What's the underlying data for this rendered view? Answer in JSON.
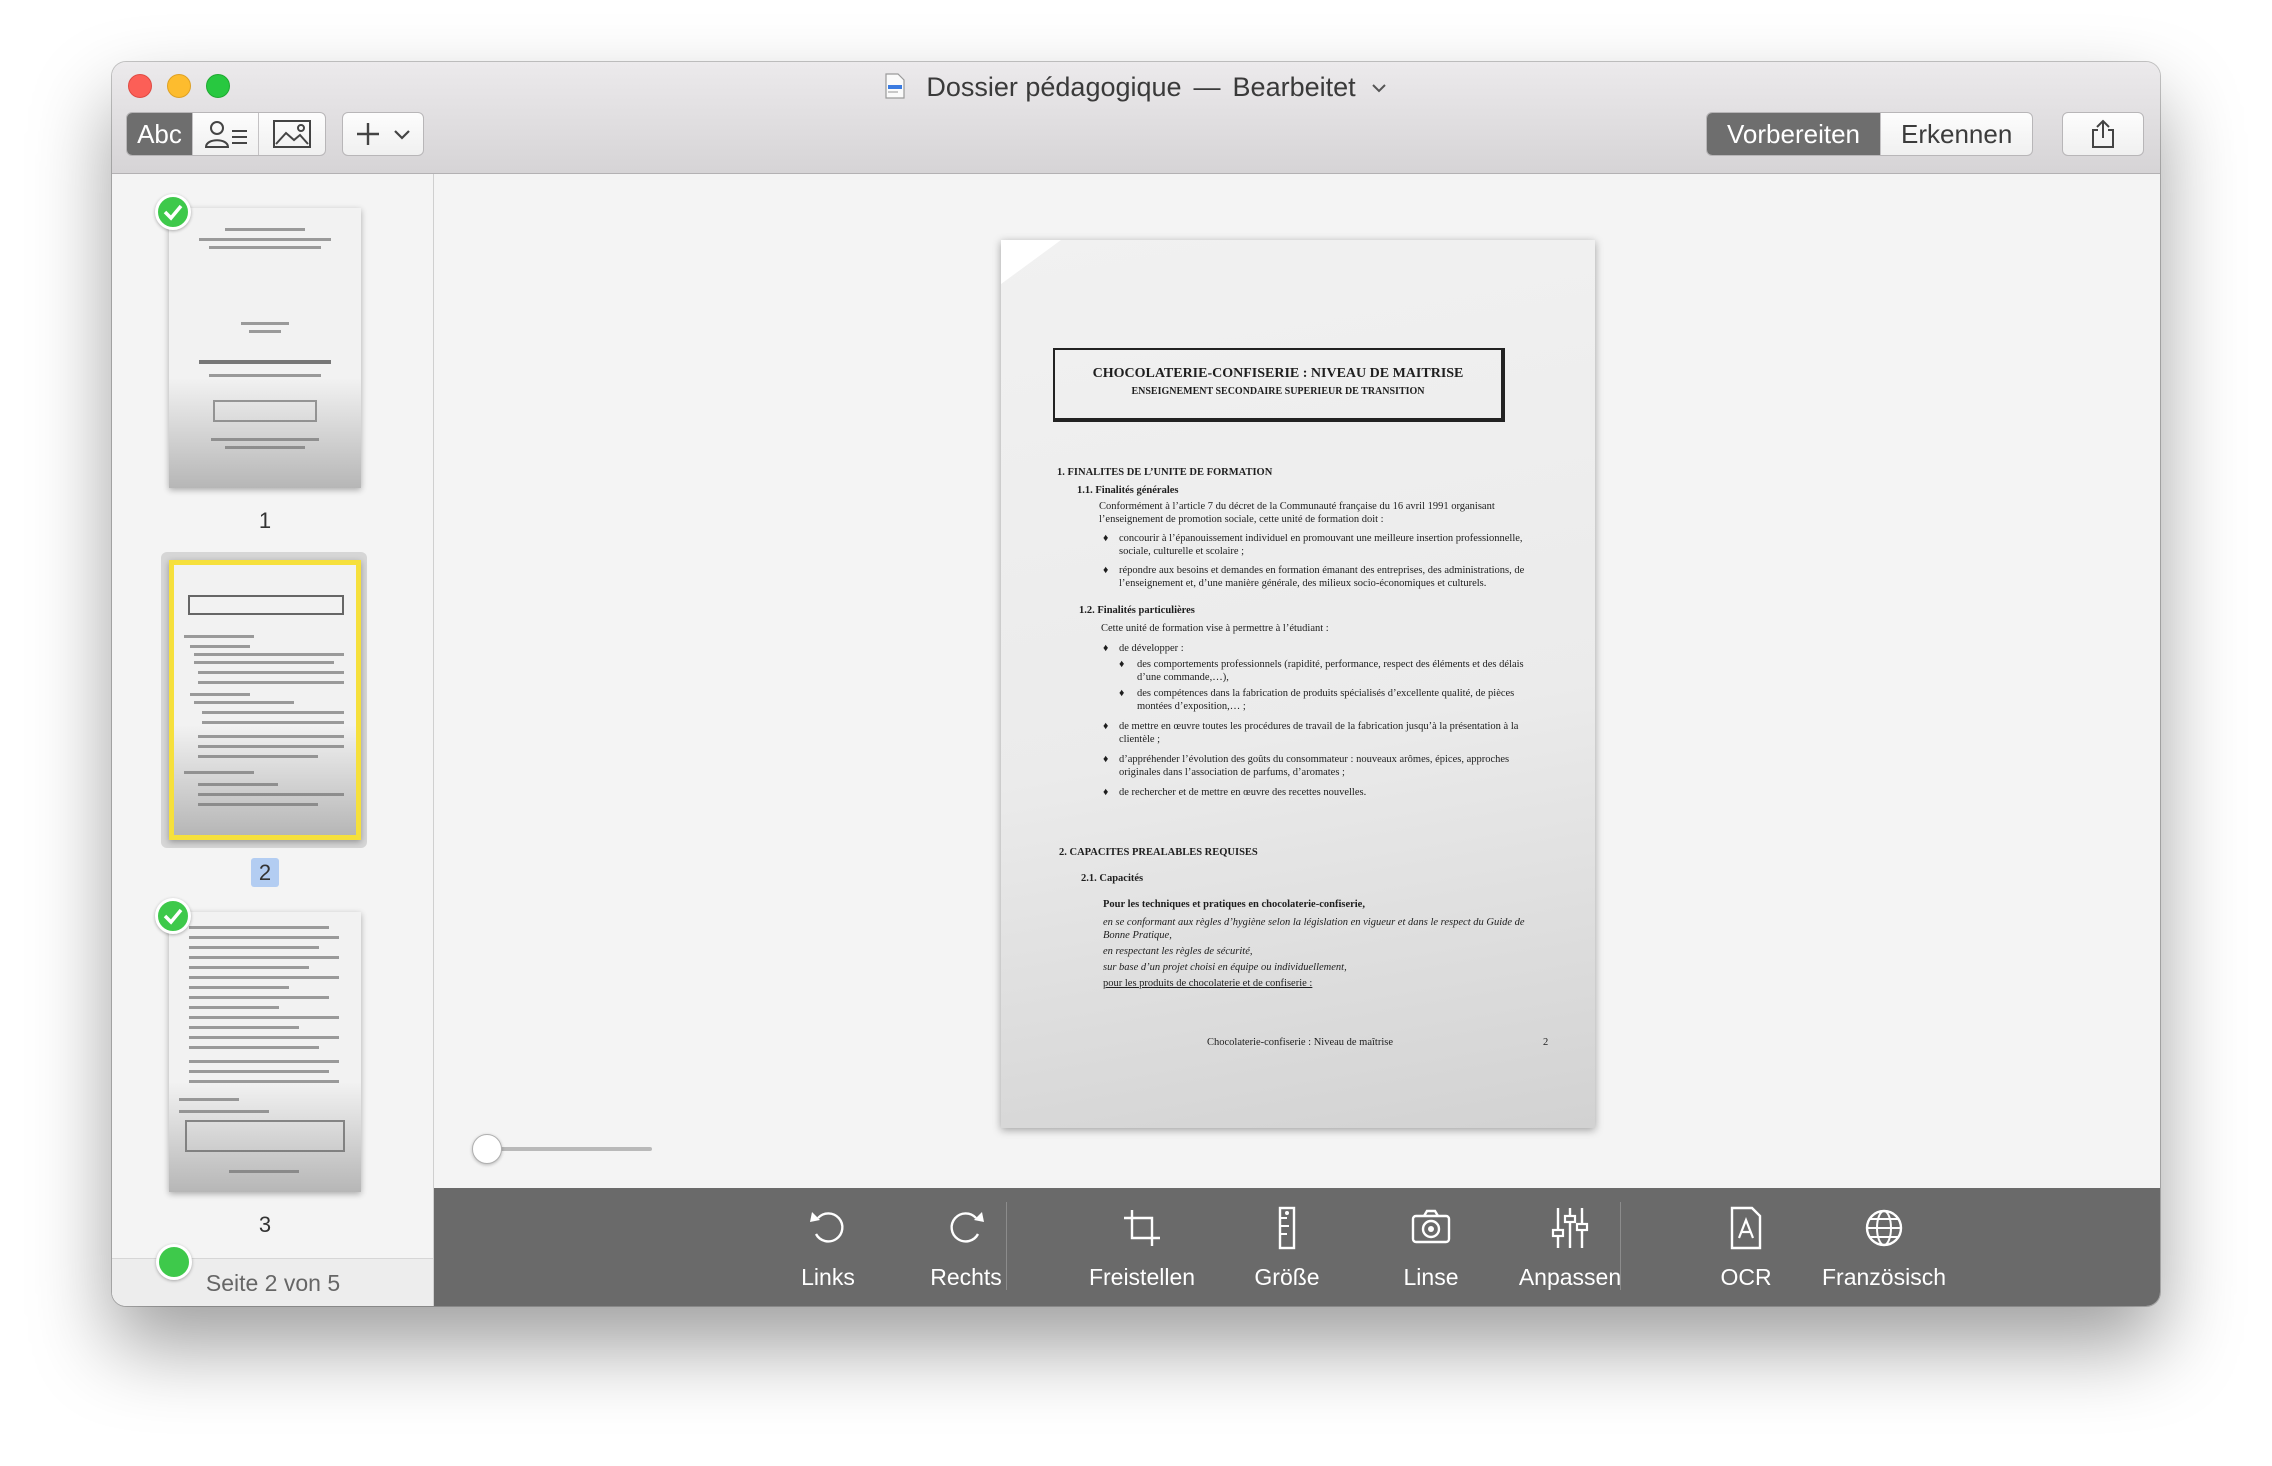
{
  "window": {
    "title": "Dossier pédagogique",
    "title_separator": "—",
    "title_status": "Bearbeitet"
  },
  "toolbar": {
    "text_mode_label": "Abc",
    "prepare_label": "Vorbereiten",
    "recognize_label": "Erkennen",
    "add_label": "+"
  },
  "sidebar": {
    "pages": [
      {
        "number": "1",
        "recognized": true
      },
      {
        "number": "2",
        "recognized": false,
        "selected": true
      },
      {
        "number": "3",
        "recognized": true
      }
    ],
    "footer": "Seite 2 von 5"
  },
  "document": {
    "title_main": "CHOCOLATERIE-CONFISERIE  : NIVEAU DE MAITRISE",
    "title_sub": "ENSEIGNEMENT SECONDAIRE SUPERIEUR DE TRANSITION",
    "s1": "1.    FINALITES DE L’UNITE DE FORMATION",
    "s11": "1.1.  Finalités générales",
    "s11_p1": "Conformément à l’article 7 du décret de la Communauté française du 16 avril 1991 organisant",
    "s11_p2": "l’enseignement de promotion sociale, cette unité de formation doit :",
    "b1a": "concourir à l’épanouissement individuel en promouvant une meilleure insertion professionnelle,",
    "b1b": "sociale, culturelle et scolaire ;",
    "b2a": "répondre aux besoins et demandes en formation émanant des entreprises, des administrations, de",
    "b2b": "l’enseignement et, d’une manière générale, des milieux socio-économiques et culturels.",
    "s12": "1.2.  Finalités particulières",
    "s12_p1": "Cette unité de formation vise à permettre à l’étudiant :",
    "c1": "de développer :",
    "c1a1": "des comportements professionnels (rapidité, performance, respect des éléments et des délais",
    "c1a2": "d’une commande,…),",
    "c1b1": "des compétences dans la fabrication de produits spécialisés d’excellente qualité, de pièces",
    "c1b2": "montées d’exposition,… ;",
    "c2a": "de mettre en œuvre  toutes les procédures de travail de la fabrication jusqu’à la présentation à la",
    "c2b": "clientèle ;",
    "c3a": "d’appréhender l’évolution des goûts du consommateur : nouveaux arômes, épices, approches",
    "c3b": "originales dans l’association de parfums, d’aromates ;",
    "c4": "de rechercher et de mettre en œuvre des recettes nouvelles.",
    "s2": "2.    CAPACITES PREALABLES REQUISES",
    "s21": "2.1.  Capacités",
    "s21_p1": "Pour les techniques et pratiques en chocolaterie-confiserie,",
    "s21_i1": "en se conformant aux règles d’hygiène selon la législation en vigueur et dans le respect du Guide de",
    "s21_i2": "Bonne Pratique,",
    "s21_i3": "en respectant les règles de sécurité,",
    "s21_i4": "sur base d’un projet choisi en équipe ou individuellement,",
    "s21_u": "pour les produits de chocolaterie et de confiserie :",
    "footer_text": "Chocolaterie-confiserie : Niveau de maîtrise",
    "footer_page": "2"
  },
  "tools": {
    "links": "Links",
    "rechts": "Rechts",
    "freistellen": "Freistellen",
    "groesse": "Größe",
    "linse": "Linse",
    "anpassen": "Anpassen",
    "ocr": "OCR",
    "sprache": "Französisch"
  },
  "colors": {
    "selection_yellow": "#f6e03c",
    "check_green": "#3ec94b",
    "bottom_bar": "#6a6a6a",
    "segment_active": "#6e6e6e"
  }
}
